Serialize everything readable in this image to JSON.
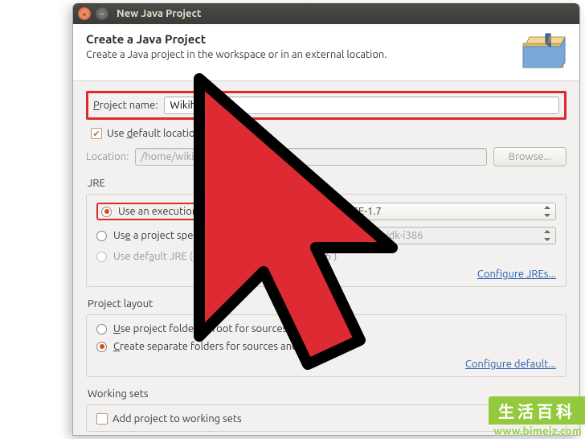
{
  "titlebar": {
    "title": "New Java Project"
  },
  "header": {
    "title": "Create a Java Project",
    "subtitle": "Create a Java project in the workspace or in an external location."
  },
  "projectName": {
    "label": "Project name:",
    "value": "Wikihow"
  },
  "defaultLocation": {
    "label": "Use default location",
    "checked": true
  },
  "location": {
    "label": "Location:",
    "value": "/home/wiki/workspace/Wikihow",
    "browse": "Browse..."
  },
  "jre": {
    "legend": "JRE",
    "execEnv": {
      "label": "Use an execution environment JRE:",
      "value": "JavaSE-1.7"
    },
    "projectJre": {
      "label": "Use a project specific JRE:",
      "value": "java-7-openjdk-i386"
    },
    "defaultJre": {
      "label": "Use default JRE (currently 'java-7-openjdk-i386')"
    },
    "configLink": "Configure JREs..."
  },
  "layout": {
    "legend": "Project layout",
    "rootFolder": "Use project folder as root for sources and class files",
    "separate": "Create separate folders for sources and class files",
    "configLink": "Configure default..."
  },
  "workingSets": {
    "legend": "Working sets",
    "add": "Add project to working sets"
  },
  "watermark": {
    "top": "生活百科",
    "url": "www.bimeiz.com"
  }
}
